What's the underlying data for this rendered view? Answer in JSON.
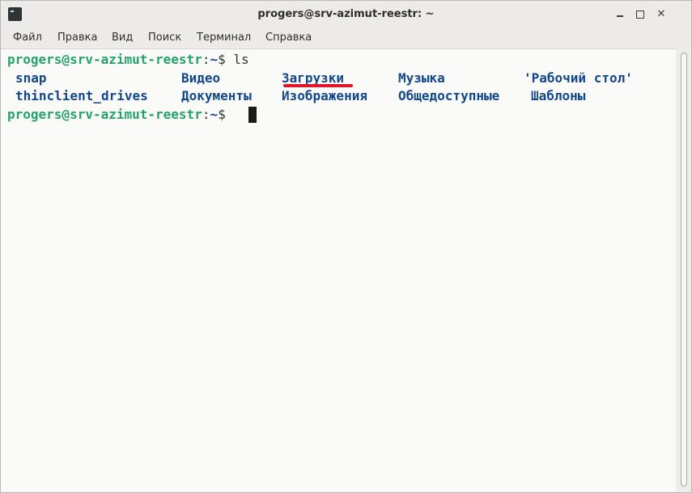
{
  "window": {
    "title": "progers@srv-azimut-reestr: ~",
    "icon": "terminal-icon",
    "controls": {
      "minimize": "minimize-icon",
      "maximize": "maximize-icon",
      "close": "✕"
    }
  },
  "menu": [
    "Файл",
    "Правка",
    "Вид",
    "Поиск",
    "Терминал",
    "Справка"
  ],
  "terminal": {
    "prompt_user": "progers@srv-azimut-reestr",
    "prompt_sep": ":",
    "prompt_path": "~",
    "prompt_sign": "$ ",
    "command": "ls",
    "row1": [
      "snap",
      "Видео",
      "Загрузки",
      "Музыка",
      "'Рабочий стол'"
    ],
    "row2": [
      "thinclient_drives",
      "Документы",
      "Изображения",
      "Общедоступные",
      "Шаблоны"
    ],
    "highlighted_entry": "Загрузки"
  },
  "colors": {
    "prompt_user": "#26a269",
    "directory": "#12488b",
    "annotation": "#e0172b",
    "background": "#fafaf9"
  }
}
